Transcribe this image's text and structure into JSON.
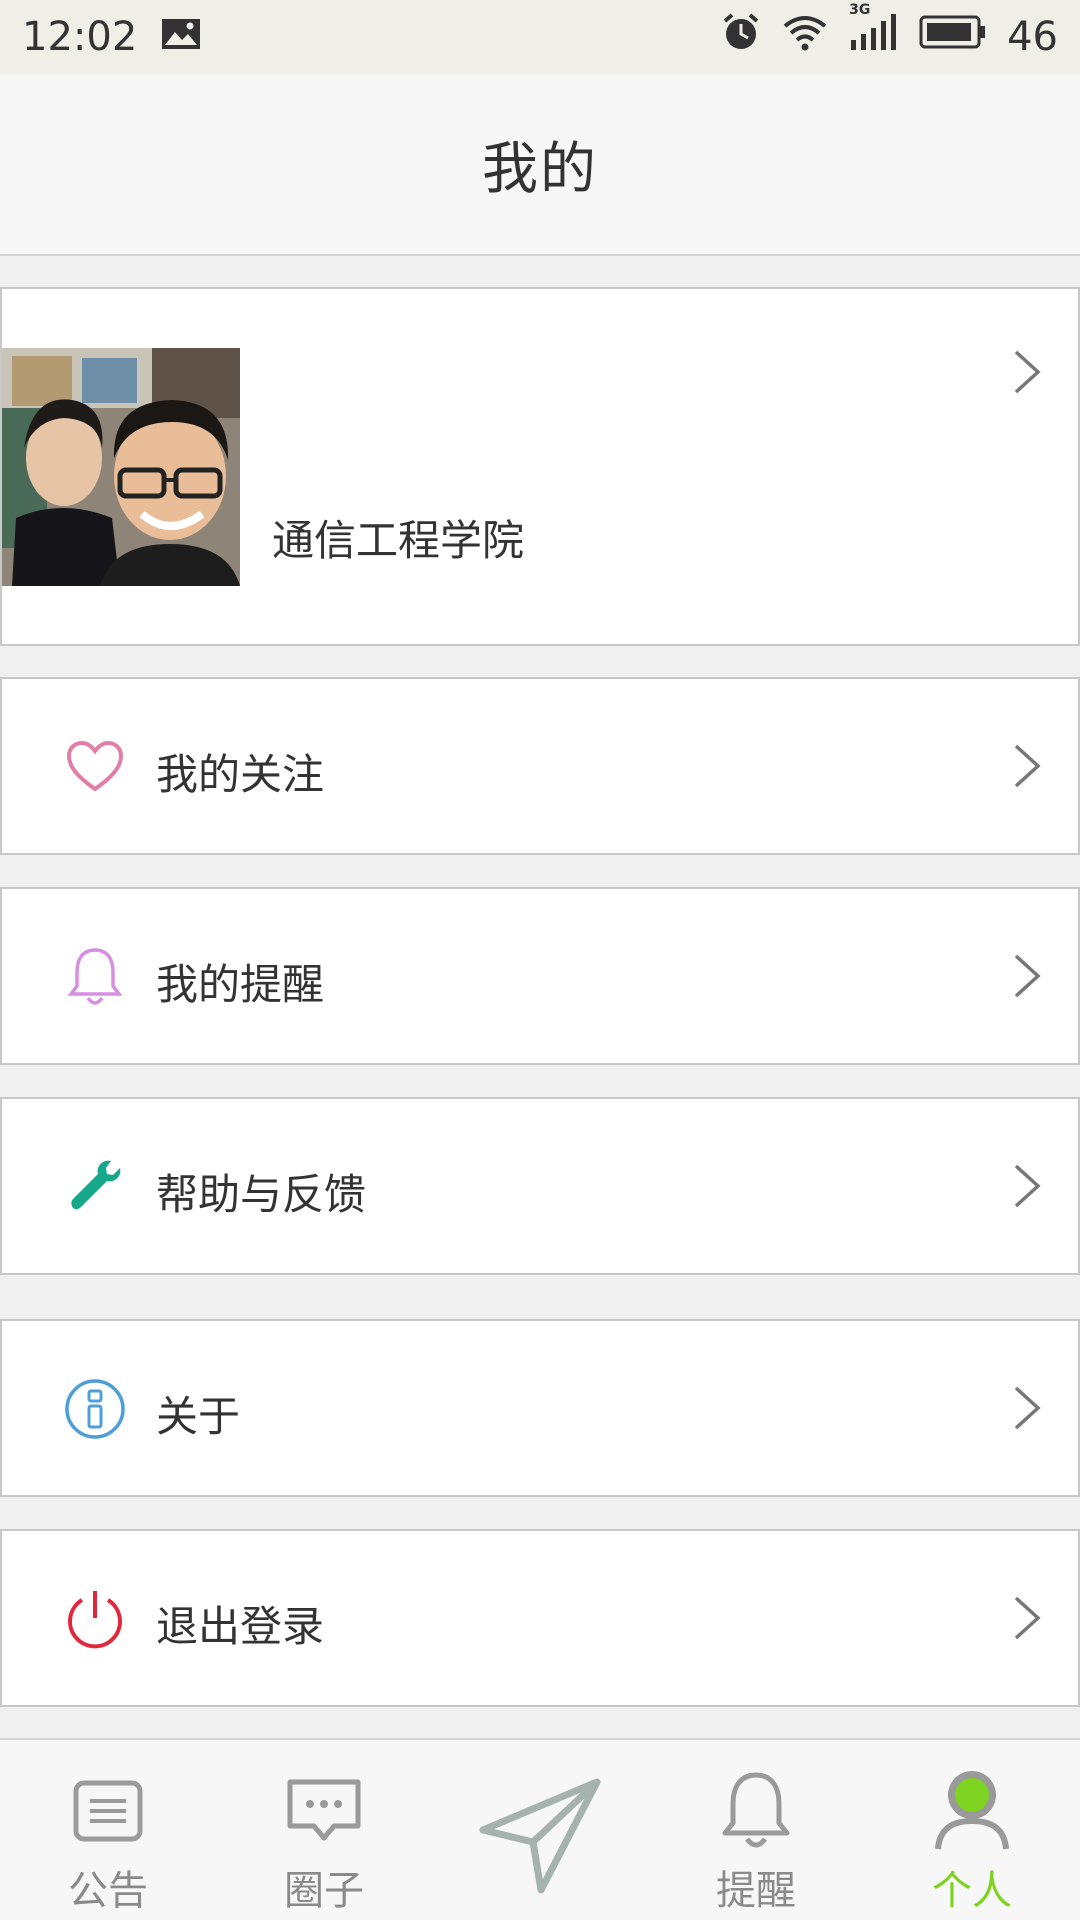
{
  "status_bar": {
    "time": "12:02",
    "network": "3G",
    "battery": "46"
  },
  "header": {
    "title": "我的"
  },
  "profile": {
    "name": "通信工程学院"
  },
  "menu": [
    {
      "label": "我的关注",
      "icon": "heart-icon",
      "color": "#e27ea6"
    },
    {
      "label": "我的提醒",
      "icon": "bell-icon",
      "color": "#d88ee0"
    },
    {
      "label": "帮助与反馈",
      "icon": "wrench-icon",
      "color": "#17a88c"
    },
    {
      "label": "关于",
      "icon": "info-icon",
      "color": "#4d9fd6"
    },
    {
      "label": "退出登录",
      "icon": "power-icon",
      "color": "#e0283a"
    }
  ],
  "tabs": [
    {
      "label": "公告",
      "icon": "notice-icon"
    },
    {
      "label": "圈子",
      "icon": "chat-icon"
    },
    {
      "label": "",
      "icon": "send-icon"
    },
    {
      "label": "提醒",
      "icon": "bell-icon"
    },
    {
      "label": "个人",
      "icon": "person-icon",
      "active": true
    }
  ],
  "colors": {
    "accent": "#7ed321",
    "tab_inactive": "#8a8a8a"
  }
}
